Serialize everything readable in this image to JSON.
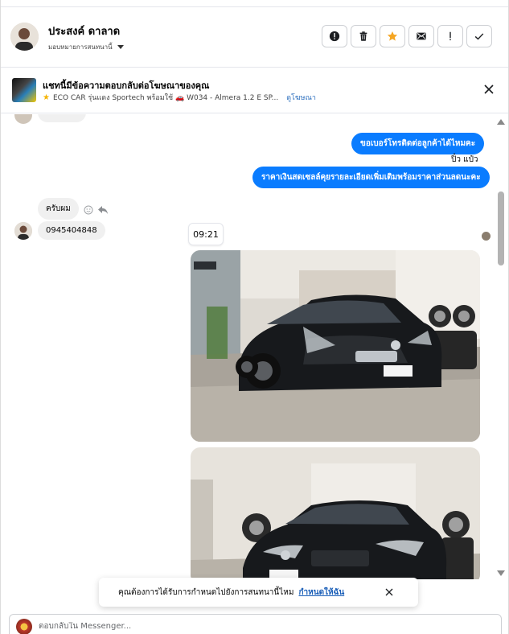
{
  "header": {
    "contact_name": "ประสงค์ ดาลาด",
    "assign_label": "มอบหมายการสนทนานี้",
    "actions": [
      {
        "icon": "alert-circle-icon",
        "label": ""
      },
      {
        "icon": "trash-icon",
        "label": ""
      },
      {
        "icon": "star-icon",
        "label": ""
      },
      {
        "icon": "mail-icon",
        "label": ""
      },
      {
        "icon": "exclamation-icon",
        "label": ""
      },
      {
        "icon": "check-icon",
        "label": ""
      }
    ]
  },
  "ad_context": {
    "title": "แชทนี้มีข้อความตอบกลับต่อโฆษณาของคุณ",
    "subtitle": "ECO CAR รุ่นแดง Sportech พร้อมใช้ 🚗 W034 - Almera 1.2 E SP...",
    "link_label": "ดูโฆษณา"
  },
  "messages": {
    "partial_top": "",
    "out_1": "ขอเบอร์โทรติดต่อลูกค้าได้ไหมคะ",
    "sender_name": "ปิ๋ว แป๋ว",
    "out_2": "ราคาเงินสดเซลล์คุยรายละเอียดเพิ่มเติมพร้อมราคาส่วนลดนะคะ",
    "in_1": "ครับผม",
    "in_2": "0945404848",
    "time": "09:21"
  },
  "photos": [
    {
      "alt": "black Nissan Almera front view in showroom",
      "plate": "จจ 5118"
    },
    {
      "alt": "black Nissan Almera front view, second photo",
      "plate": "จจ 5118"
    }
  ],
  "toast": {
    "text": "คุณต้องการได้รับการกำหนดไปยังการสนทนานี้ไหม",
    "link": "กำหนดให้ฉัน"
  },
  "composer": {
    "placeholder": "ตอบกลับใน Messenger..."
  },
  "colors": {
    "outgoing_bubble": "#0a7cff",
    "incoming_bubble": "#f0f0f0",
    "star_active": "#f5a623",
    "link": "#2c6fbe"
  }
}
